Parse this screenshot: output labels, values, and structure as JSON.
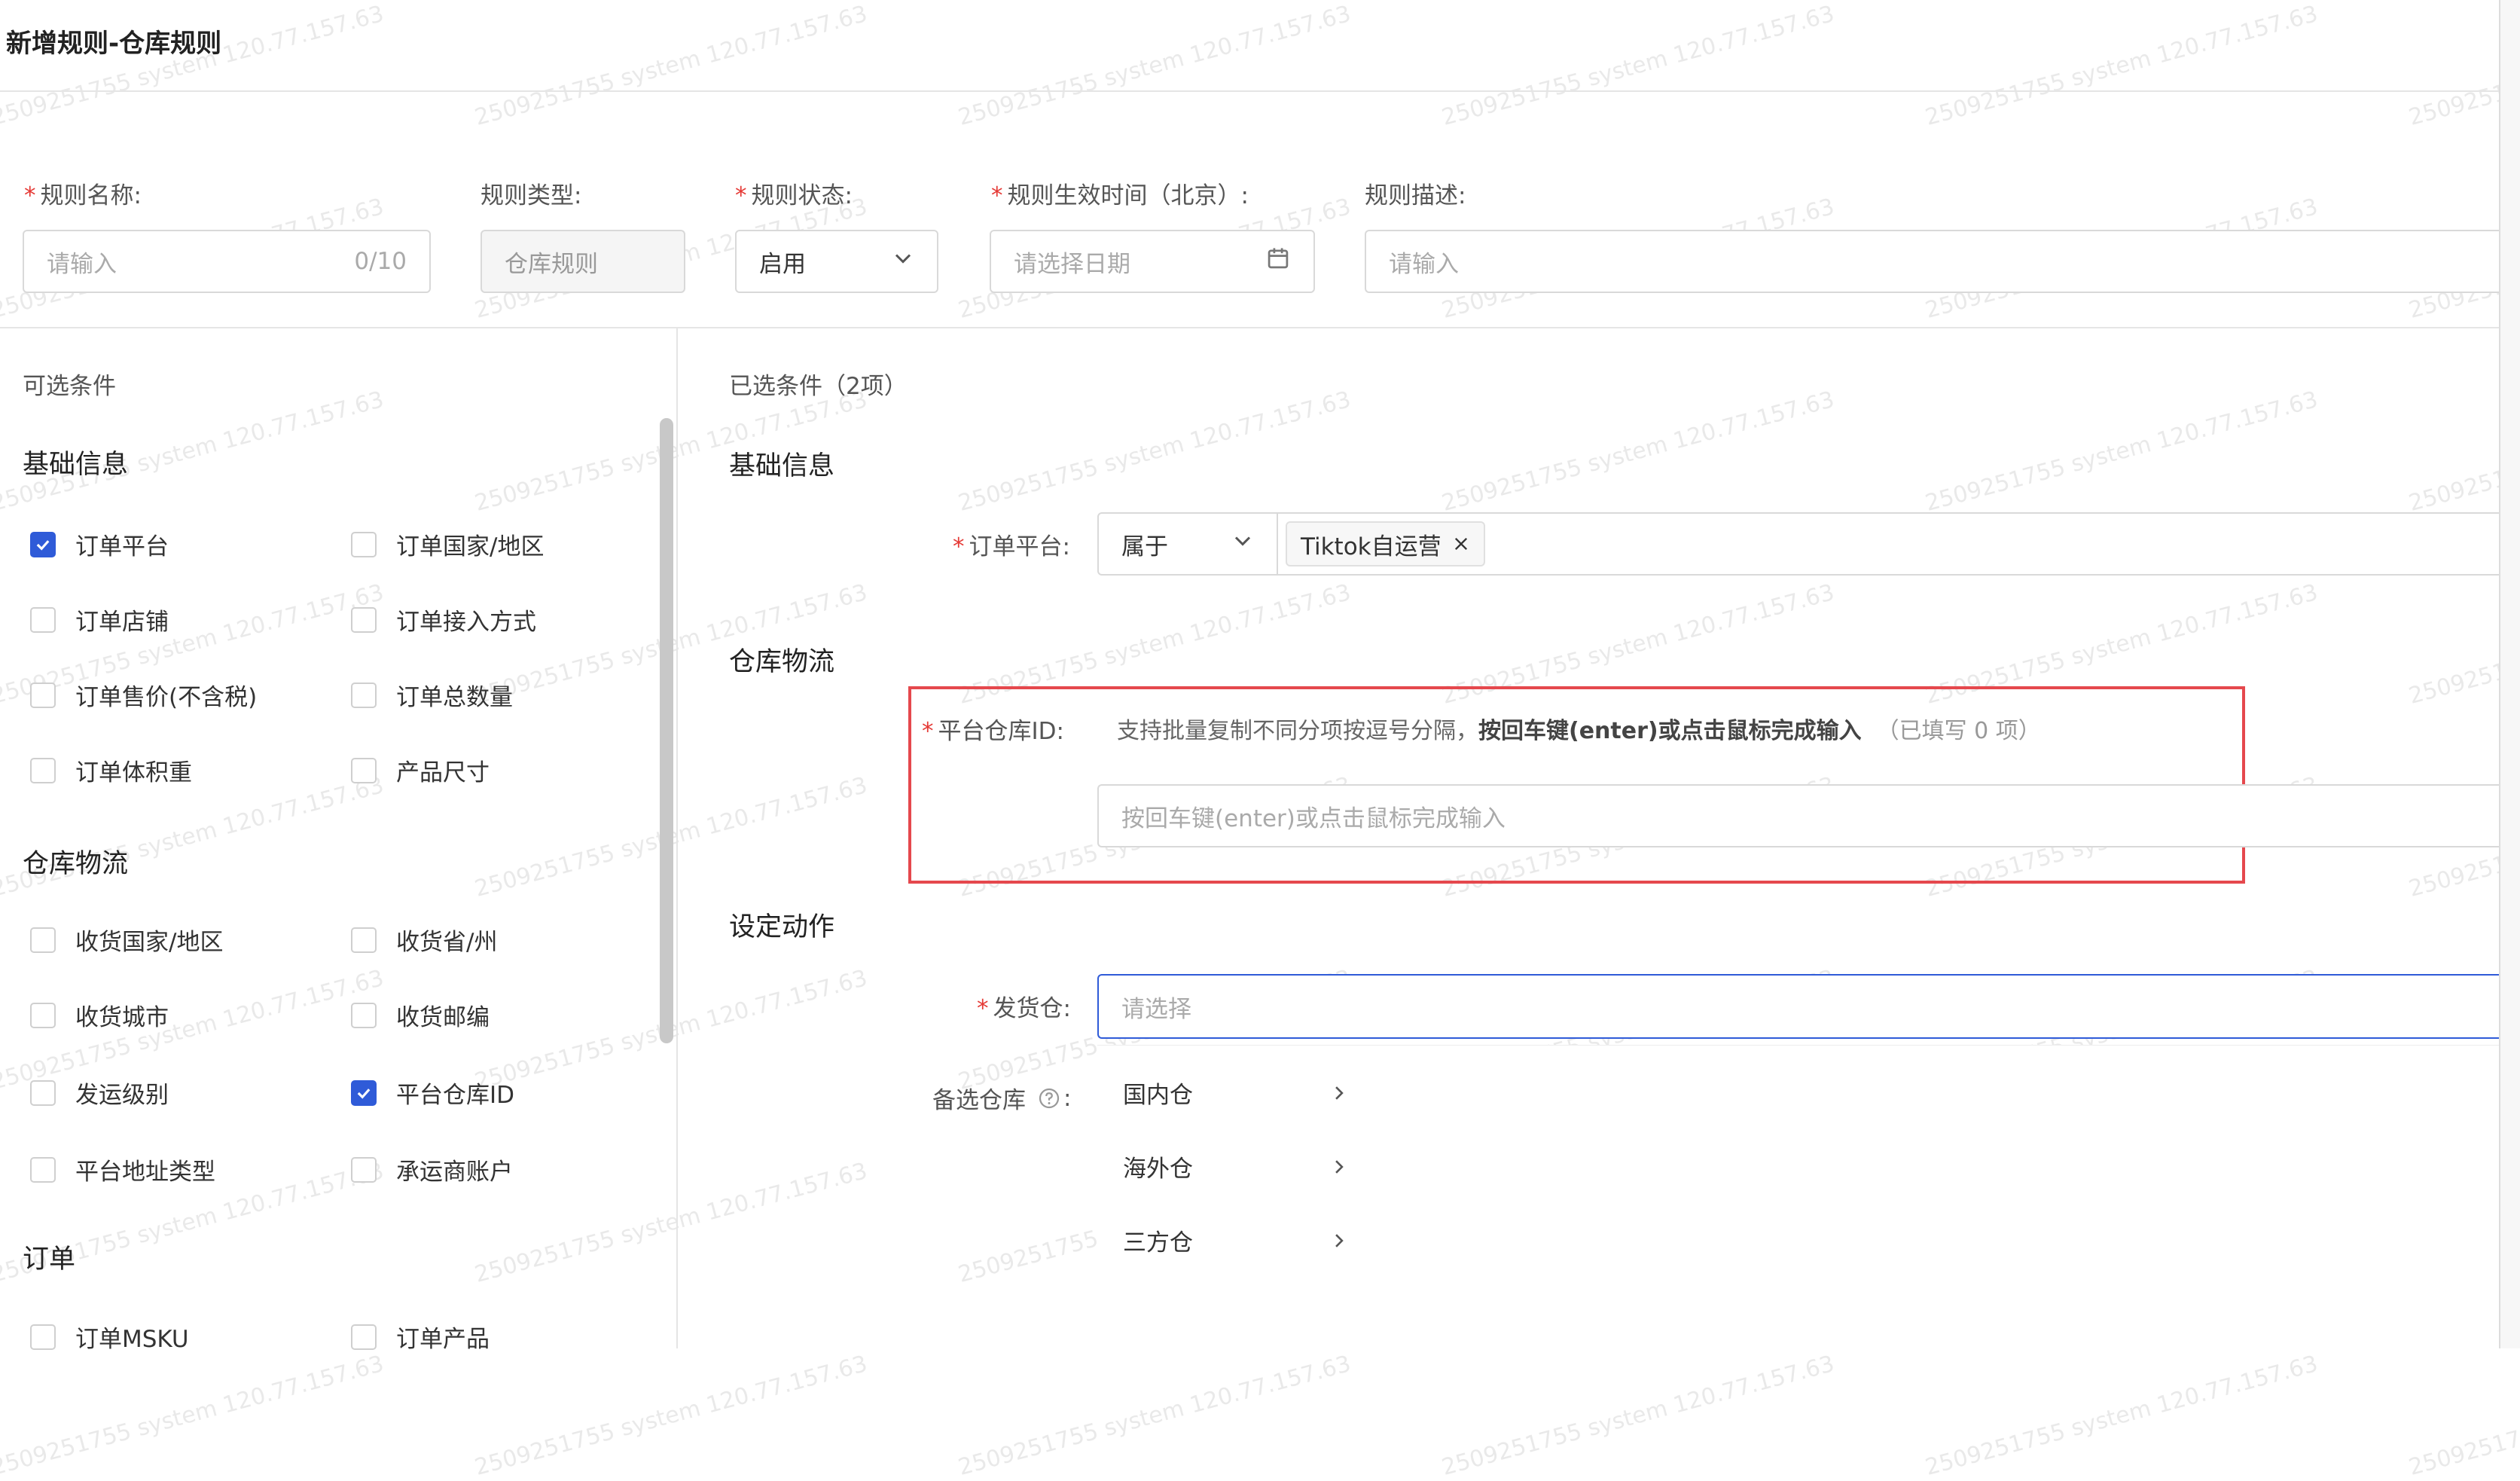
{
  "header": {
    "title": "新增规则-仓库规则"
  },
  "form": {
    "rule_name": {
      "label": "规则名称:",
      "placeholder": "请输入",
      "counter": "0/10"
    },
    "rule_type": {
      "label": "规则类型:",
      "value": "仓库规则"
    },
    "rule_status": {
      "label": "规则状态:",
      "value": "启用"
    },
    "effective_time": {
      "label": "规则生效时间（北京）:",
      "placeholder": "请选择日期"
    },
    "rule_desc": {
      "label": "规则描述:",
      "placeholder": "请输入"
    }
  },
  "left_panel": {
    "title": "可选条件",
    "sections": [
      {
        "title": "基础信息",
        "items": [
          {
            "label": "订单平台",
            "checked": true
          },
          {
            "label": "订单国家/地区",
            "checked": false
          },
          {
            "label": "订单店铺",
            "checked": false
          },
          {
            "label": "订单接入方式",
            "checked": false
          },
          {
            "label": "订单售价(不含税)",
            "checked": false
          },
          {
            "label": "订单总数量",
            "checked": false
          },
          {
            "label": "订单体积重",
            "checked": false
          },
          {
            "label": "产品尺寸",
            "checked": false
          }
        ]
      },
      {
        "title": "仓库物流",
        "items": [
          {
            "label": "收货国家/地区",
            "checked": false
          },
          {
            "label": "收货省/州",
            "checked": false
          },
          {
            "label": "收货城市",
            "checked": false
          },
          {
            "label": "收货邮编",
            "checked": false
          },
          {
            "label": "发运级别",
            "checked": false
          },
          {
            "label": "平台仓库ID",
            "checked": true
          },
          {
            "label": "平台地址类型",
            "checked": false
          },
          {
            "label": "承运商账户",
            "checked": false
          }
        ]
      },
      {
        "title": "订单",
        "items": [
          {
            "label": "订单MSKU",
            "checked": false
          },
          {
            "label": "订单产品",
            "checked": false
          }
        ]
      }
    ]
  },
  "right_panel": {
    "title": "已选条件（2项）",
    "basic_section": "基础信息",
    "order_platform": {
      "label": "订单平台:",
      "operator": "属于",
      "tag": "Tiktok自运营"
    },
    "logistics_section": "仓库物流",
    "platform_warehouse": {
      "label": "平台仓库ID:",
      "hint": "支持批量复制不同分项按逗号分隔，",
      "hint_bold": "按回车键(enter)或点击鼠标完成输入",
      "filled": "（已填写 0 项）",
      "placeholder": "按回车键(enter)或点击鼠标完成输入"
    },
    "action_section": "设定动作",
    "ship_warehouse": {
      "label": "发货仓:",
      "placeholder": "请选择"
    },
    "backup_warehouse": {
      "label": "备选仓库",
      "colon": ":"
    },
    "dropdown": [
      "国内仓",
      "海外仓",
      "三方仓"
    ]
  },
  "watermark": "2509251755 system 120.77.157.63",
  "colors": {
    "accent": "#2f5bd8",
    "required": "#e53935",
    "highlight_box": "#e5484d"
  },
  "icons": {
    "chevron": "chevron-down-icon",
    "calendar": "calendar-icon",
    "close": "close-icon",
    "help": "question-icon",
    "expand": "chevron-right-icon",
    "check": "check-icon"
  }
}
